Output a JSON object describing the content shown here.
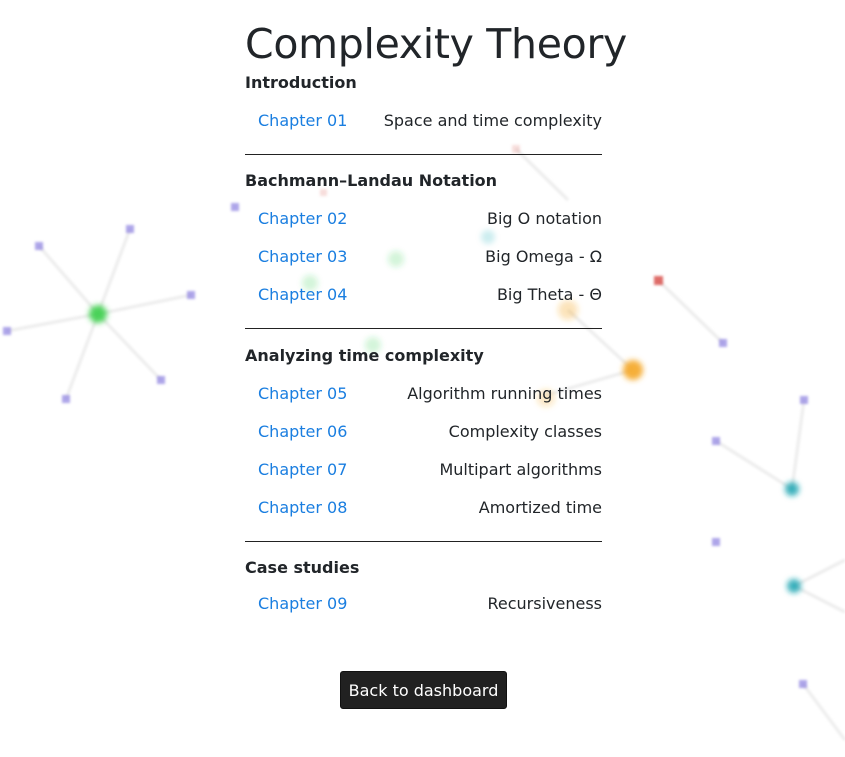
{
  "page": {
    "title": "Complexity Theory"
  },
  "sections": [
    {
      "title": "Introduction",
      "chapters": [
        {
          "label": "Chapter 01",
          "topic": "Space and time complexity"
        }
      ]
    },
    {
      "title": "Bachmann–Landau Notation",
      "chapters": [
        {
          "label": "Chapter 02",
          "topic": "Big O notation"
        },
        {
          "label": "Chapter 03",
          "topic": "Big Omega - Ω"
        },
        {
          "label": "Chapter 04",
          "topic": "Big Theta - Θ"
        }
      ]
    },
    {
      "title": "Analyzing time complexity",
      "chapters": [
        {
          "label": "Chapter 05",
          "topic": "Algorithm running times"
        },
        {
          "label": "Chapter 06",
          "topic": "Complexity classes"
        },
        {
          "label": "Chapter 07",
          "topic": "Multipart algorithms"
        },
        {
          "label": "Chapter 08",
          "topic": "Amortized time"
        }
      ]
    },
    {
      "title": "Case studies",
      "chapters": [
        {
          "label": "Chapter 09",
          "topic": "Recursiveness"
        }
      ]
    }
  ],
  "footer": {
    "back_label": "Back to dashboard"
  },
  "colors": {
    "link": "#1a7ee0",
    "button_bg": "#212121",
    "node_purple": "#8a7fe0",
    "node_green": "#2ecc40",
    "node_orange": "#f5a623",
    "node_teal": "#16a3b0",
    "node_red": "#d9534f"
  }
}
